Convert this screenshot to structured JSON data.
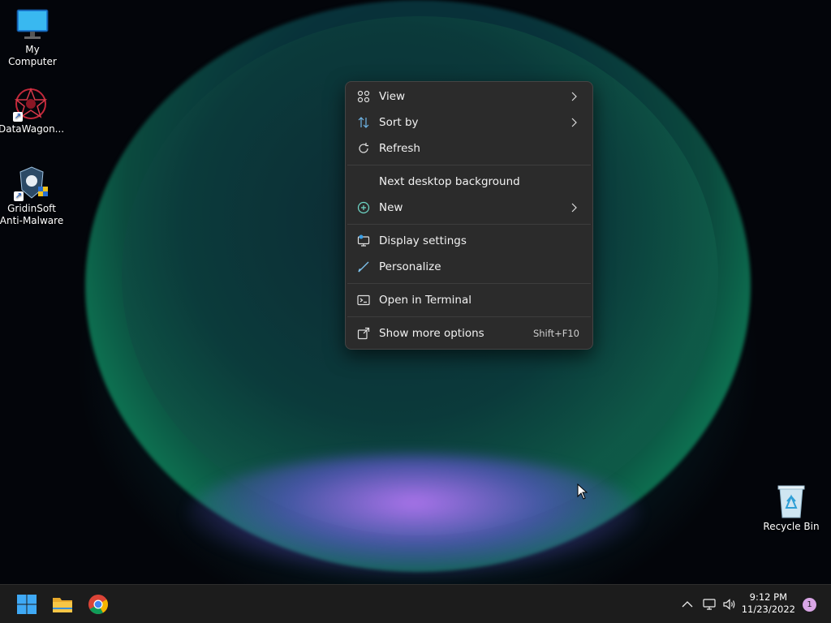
{
  "desktop": {
    "icons": [
      {
        "label": "My Computer"
      },
      {
        "label": "DataWagon..."
      },
      {
        "label": "GridinSoft Anti-Malware"
      },
      {
        "label": "Recycle Bin"
      }
    ]
  },
  "context_menu": {
    "items": [
      {
        "label": "View",
        "icon": "grid-icon",
        "submenu": true
      },
      {
        "label": "Sort by",
        "icon": "sort-arrows-icon",
        "submenu": true
      },
      {
        "label": "Refresh",
        "icon": "refresh-icon"
      },
      {
        "label": "Next desktop background"
      },
      {
        "label": "New",
        "icon": "plus-circle-icon",
        "submenu": true
      },
      {
        "label": "Display settings",
        "icon": "display-icon"
      },
      {
        "label": "Personalize",
        "icon": "brush-icon"
      },
      {
        "label": "Open in Terminal",
        "icon": "terminal-icon"
      },
      {
        "label": "Show more options",
        "icon": "share-icon",
        "shortcut": "Shift+F10"
      }
    ]
  },
  "taskbar": {
    "clock_time": "9:12 PM",
    "clock_date": "11/23/2022",
    "notification_count": "1",
    "pinned": [
      "start-icon",
      "file-explorer-icon",
      "chrome-icon"
    ]
  }
}
